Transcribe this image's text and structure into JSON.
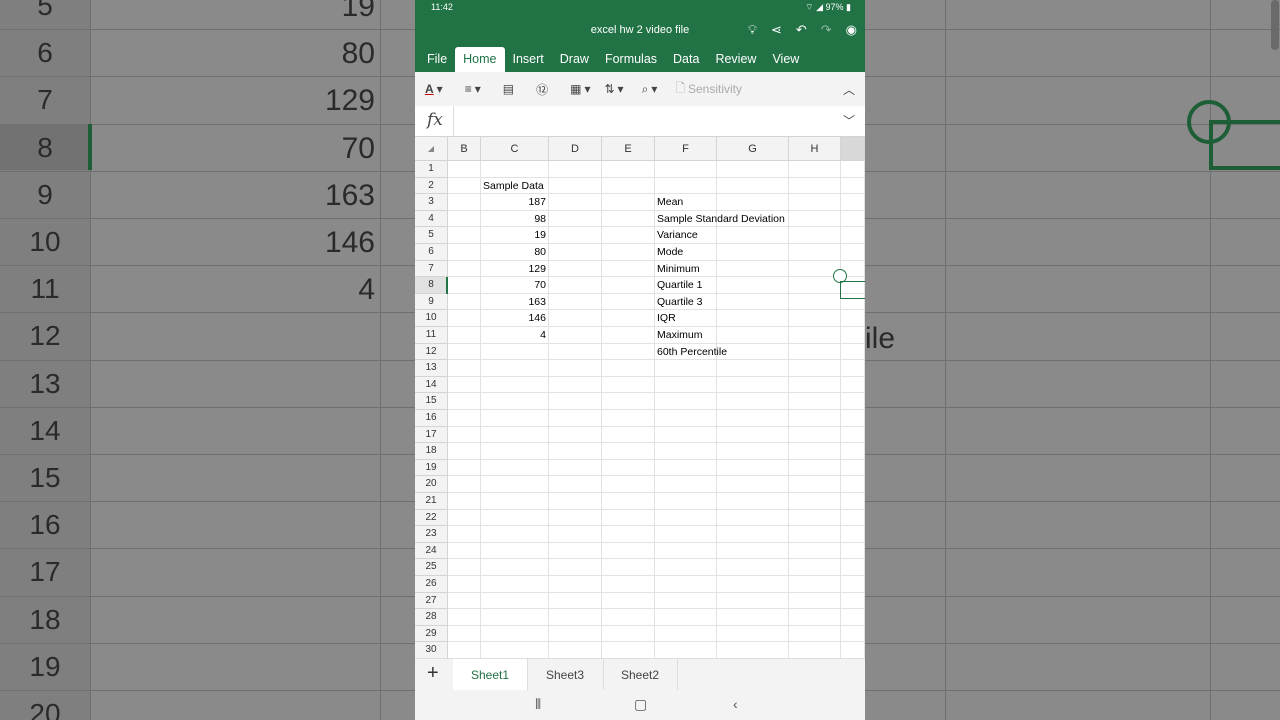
{
  "status": {
    "time": "11:42",
    "battery": "97%"
  },
  "window": {
    "title": "excel hw 2 video file"
  },
  "menu_tabs": [
    "File",
    "Home",
    "Insert",
    "Draw",
    "Formulas",
    "Data",
    "Review",
    "View"
  ],
  "active_tab": "Home",
  "ribbon": {
    "sensitivity_label": "Sensitivity"
  },
  "formula_bar": {
    "fx_label": "fx",
    "value": ""
  },
  "columns": [
    "B",
    "C",
    "D",
    "E",
    "F",
    "G",
    "H"
  ],
  "rows": [
    "1",
    "2",
    "3",
    "4",
    "5",
    "6",
    "7",
    "8",
    "9",
    "10",
    "11",
    "12",
    "13",
    "14",
    "15",
    "16",
    "17",
    "18",
    "19",
    "20",
    "21",
    "22",
    "23",
    "24",
    "25",
    "26",
    "27",
    "28",
    "29",
    "30"
  ],
  "cells": {
    "C2": "Sample Data",
    "C3": "187",
    "C4": "98",
    "C5": "19",
    "C6": "80",
    "C7": "129",
    "C8": "70",
    "C9": "163",
    "C10": "146",
    "C11": "4",
    "F3": "Mean",
    "F4": "Sample Standard Deviation",
    "F5": "Variance",
    "F6": "Mode",
    "F7": "Minimum",
    "F8": "Quartile 1",
    "F9": "Quartile 3",
    "F10": "IQR",
    "F11": "Maximum",
    "F12": "60th Percentile"
  },
  "sheets": [
    "Sheet1",
    "Sheet3",
    "Sheet2"
  ],
  "active_sheet": "Sheet1",
  "background": {
    "left_rows": [
      "5",
      "6",
      "7",
      "8",
      "9",
      "10",
      "11",
      "12",
      "13",
      "14",
      "15",
      "16",
      "17",
      "18",
      "19",
      "20"
    ],
    "left_values": [
      "19",
      "80",
      "129",
      "70",
      "163",
      "146",
      "4"
    ],
    "right_text": "ile"
  },
  "colors": {
    "excel_green": "#217346"
  }
}
